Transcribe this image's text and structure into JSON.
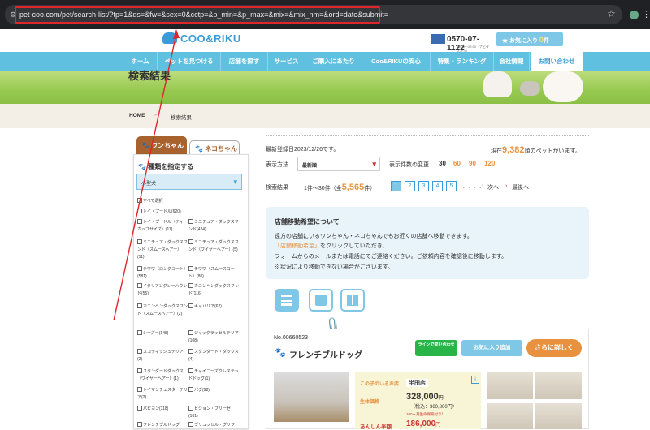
{
  "browser": {
    "url": "pet-coo.com/pet/search-list/?tp=1&ds=&fw=&sex=0&cctp=&p_min=&p_max=&mix=&mix_nm=&ord=date&submit="
  },
  "header": {
    "logo": "COO&RIKU",
    "phone": "0570-07-1122",
    "phone_hours": "10:00〜22:00（ナビダイヤル）",
    "favorites_label": "お気に入り",
    "favorites_count": "0",
    "favorites_suffix": "件"
  },
  "nav": {
    "items": [
      "ホーム",
      "ペットを見つける",
      "店舗を探す",
      "サービス",
      "ご購入にあたり",
      "Coo&RIKUの安心",
      "特集・ランキング",
      "会社情報",
      "お問い合わせ"
    ]
  },
  "page_title": "検索結果",
  "breadcrumb": {
    "home": "HOME",
    "sep": "»",
    "current": "検索結果"
  },
  "tabs": {
    "dog": "ワンちゃん",
    "cat": "ネコちゃん"
  },
  "sidebar": {
    "heading": "種類を指定する",
    "select_value": "小型犬",
    "breeds": [
      "すべて選択",
      "トイ・プードル(620)",
      "トイ・プードル（ティーカップサイズ）(11)",
      "ミニチュア・ダックスフンド(424)",
      "ミニチュア・ダックスフンド（スムースヘアー）(11)",
      "ミニチュア・ダックスフンド（ワイヤーヘアー）(5)",
      "チワワ（ロングコート）(581)",
      "チワワ（スムースコート）(80)",
      "イタリアングレーハウンド(55)",
      "カニンヘンダックスフンド(116)",
      "カニンヘンダックスフンド（スムースヘアー）(2)",
      "キャバリア(62)",
      "シーズー(148)",
      "ジャックラッセルテリア(108)",
      "スコティッシュテリア(2)",
      "スタンダード・ダックス(4)",
      "スタンダードダックス（ワイヤーヘアー）(1)",
      "チャイニーズクレステッドドッグ(1)",
      "トイマンチェスターテリア(2)",
      "パグ(98)",
      "パピヨン(118)",
      "ビション・フリーゼ(101)",
      "フレンチブルドッグ",
      "ブリュッセル・グリフ"
    ]
  },
  "results": {
    "last_registered": "最新登録日2023/12/26です。",
    "count_prefix": "現在",
    "count": "9,382",
    "count_suffix": "頭のペットがいます。",
    "sort_label": "表示方法",
    "sort_value": "最新順",
    "per_page_label": "表示件数の変更",
    "per_page_options": [
      "30",
      "60",
      "90",
      "120"
    ],
    "result_label": "検索結果",
    "range": "1件〜30件（全",
    "total": "5,565",
    "total_suffix": "件）",
    "pages": [
      "1",
      "2",
      "3",
      "4",
      "5"
    ],
    "ellipsis": "・・・・",
    "next": "次へ",
    "last": "最後へ"
  },
  "notice": {
    "title": "店舗移動希望について",
    "line1": "遠方の店舗にいるワンちゃん・ネコちゃんでもお近くの店舗へ移動できます。",
    "line2_link": "「店舗移動希望」",
    "line2_rest": "をクリックしていただき、",
    "line3": "フォームからのメールまたは電話にてご連絡ください。ご依頼内容を確認後に移動します。",
    "line4": "※状況により移動できない場合がございます。"
  },
  "card": {
    "number": "No.00660523",
    "breed": "フレンチブルドッグ",
    "line_btn": "ラインで問い合わせ",
    "fav_btn": "お気に入り追加",
    "more_btn": "さらに詳しく",
    "shop_label": "この子のいるお店",
    "shop": "半田店",
    "price_label": "生体価格",
    "price": "328,000",
    "price_unit": "円",
    "tax": "（税込：360,800円）",
    "promo": "100ヶ月生命保険付き！",
    "half_label": "あんしん半額",
    "half_price": "186,000",
    "half_unit": "円"
  },
  "colors": {
    "accent": "#5fc0e0",
    "orange": "#e8923f",
    "brown": "#a8622e",
    "highlight": "#e0252b"
  }
}
